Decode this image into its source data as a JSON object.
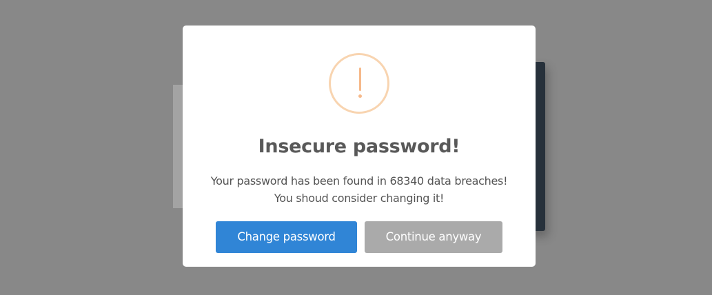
{
  "dialog": {
    "icon": "warning-exclamation-icon",
    "title": "Insecure password!",
    "message_line1": "Your password has been found in 68340 data breaches!",
    "message_line2": "You shoud consider changing it!",
    "confirm_label": "Change password",
    "cancel_label": "Continue anyway"
  },
  "colors": {
    "overlay": "#888888",
    "confirm_button": "#3085d6",
    "cancel_button": "#aaaaaa",
    "warning_icon": "#f8bb86"
  }
}
